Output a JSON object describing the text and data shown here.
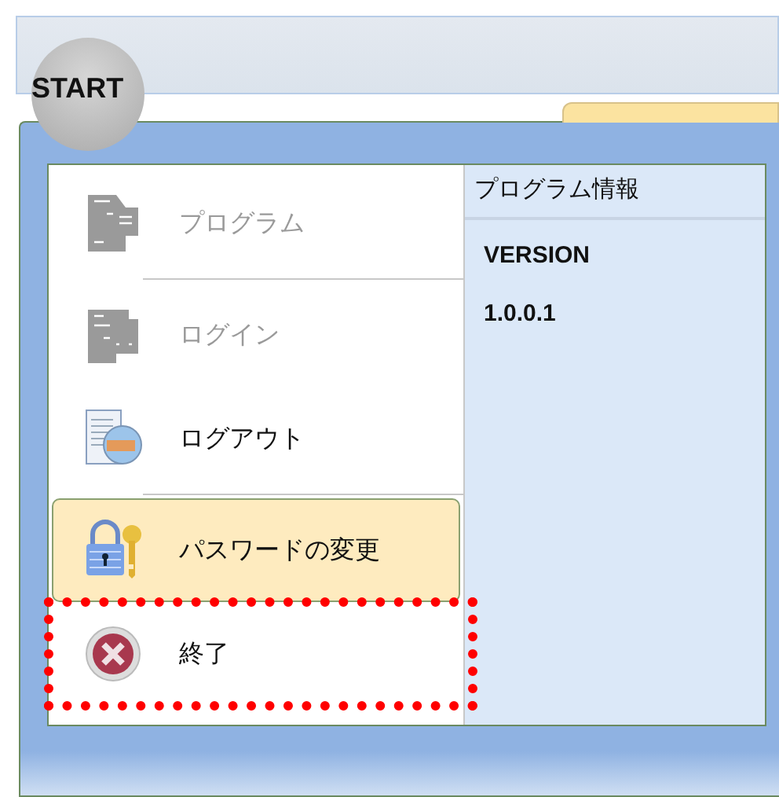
{
  "start_button": {
    "label": "START"
  },
  "menu_items": [
    {
      "kind": "program",
      "label": "プログラム",
      "disabled": true,
      "selected": false,
      "marked": false,
      "separator_after": true
    },
    {
      "kind": "login",
      "label": "ログイン",
      "disabled": true,
      "selected": false,
      "marked": false,
      "separator_after": false
    },
    {
      "kind": "logout",
      "label": "ログアウト",
      "disabled": false,
      "selected": false,
      "marked": false,
      "separator_after": true
    },
    {
      "kind": "password",
      "label": "パスワードの変更",
      "disabled": false,
      "selected": true,
      "marked": false,
      "separator_after": false
    },
    {
      "kind": "exit",
      "label": "終了",
      "disabled": false,
      "selected": false,
      "marked": true,
      "separator_after": false
    }
  ],
  "info_panel": {
    "title": "プログラム情報",
    "lines": [
      "VERSION",
      "1.0.0.1"
    ]
  }
}
